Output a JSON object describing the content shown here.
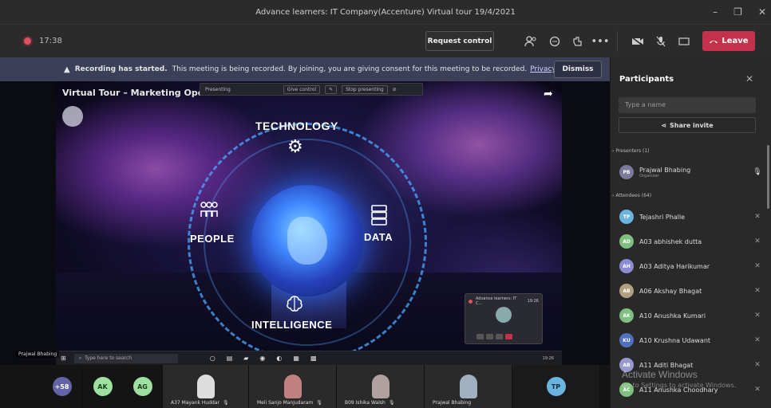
{
  "window": {
    "title": "Advance learners: IT Company(Accenture) Virtual tour 19/4/2021"
  },
  "window_controls": {
    "minimize": "–",
    "restore": "❐",
    "close": "✕"
  },
  "toolbar": {
    "timer": "17:38",
    "request_control": "Request control",
    "leave_label": "Leave",
    "icons": [
      "participants-icon",
      "chat-icon",
      "reactions-icon",
      "more-icon",
      "camera-off-icon",
      "mic-off-icon",
      "share-tray-icon"
    ]
  },
  "banner": {
    "bold": "Recording has started.",
    "text": "This meeting is being recorded. By joining, you are giving consent for this meeting to be recorded.",
    "link": "Privacy policy",
    "dismiss": "Dismiss"
  },
  "stage": {
    "overlay_title": "Virtual Tour – Marketing Operatio",
    "presenting_bar": {
      "presenting": "Presenting",
      "give_control": "Give control",
      "stop": "Stop presenting"
    },
    "slide_labels": {
      "top": "TECHNOLOGY",
      "left": "PEOPLE",
      "right": "DATA",
      "bottom": "INTELLIGENCE"
    },
    "mini_window_title": "Advance learners: IT C...",
    "mini_window_time": "19:26",
    "presenter_name": "Prajwal Bhabing",
    "taskbar_search": "Type here to search",
    "taskbar_tray": "19:26"
  },
  "strip": {
    "overflow": "+58",
    "tiles": [
      {
        "initials": "AK",
        "color": "#9ee0a0"
      },
      {
        "initials": "AG",
        "color": "#9ee0a0"
      }
    ],
    "video_tiles": [
      {
        "name": "A37 Mayank Huddar"
      },
      {
        "name": "Meli Sanjo Manjudaram"
      },
      {
        "name": "B09 Ishika Walsh"
      },
      {
        "name": "Prajwal Bhabing"
      }
    ],
    "tp": {
      "initials": "TP",
      "color": "#6bb4e0"
    }
  },
  "panel": {
    "title": "Participants",
    "search_placeholder": "Type a name",
    "share_invite": "Share invite",
    "presenters_header": "Presenters (1)",
    "attendees_header": "Attendees (64)",
    "presenters": [
      {
        "name": "Prajwal Bhabing",
        "role": "Organizer",
        "initials": "PB",
        "color": "#7a7a9a"
      }
    ],
    "attendees": [
      {
        "name": "Tejashri Phalle",
        "initials": "TP",
        "color": "#6bb4e0"
      },
      {
        "name": "A03 abhishek dutta",
        "initials": "AD",
        "color": "#7fbf7f"
      },
      {
        "name": "A03 Aditya Harikumar",
        "initials": "AH",
        "color": "#8c8cd6"
      },
      {
        "name": "A06 Akshay Bhagat",
        "initials": "AB",
        "color": "#b0a080"
      },
      {
        "name": "A10 Anushka Kumari",
        "initials": "AK",
        "color": "#7fbf7f"
      },
      {
        "name": "A10 Krushna Udawant",
        "initials": "KU",
        "color": "#5070c0"
      },
      {
        "name": "A11 Aditi Bhagat",
        "initials": "AB",
        "color": "#9a9ad0"
      },
      {
        "name": "A11 Anushka Choodhary",
        "initials": "AC",
        "color": "#7fbf7f"
      }
    ]
  },
  "watermark": {
    "line1": "Activate Windows",
    "line2": "Go to Settings to activate Windows."
  }
}
